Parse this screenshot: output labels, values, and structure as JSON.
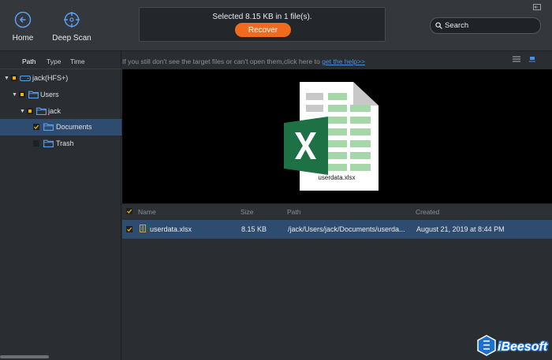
{
  "toolbar": {
    "home_label": "Home",
    "deep_scan_label": "Deep Scan",
    "status_text": "Selected 8.15 KB in 1 file(s).",
    "recover_label": "Recover",
    "search_placeholder": "Search"
  },
  "sidebar": {
    "tabs": [
      {
        "label": "Path",
        "active": true
      },
      {
        "label": "Type",
        "active": false
      },
      {
        "label": "Time",
        "active": false
      }
    ],
    "tree": [
      {
        "label": "jack(HFS+)",
        "expanded": true,
        "check": "partial",
        "icon": "drive-icon"
      },
      {
        "label": "Users",
        "expanded": true,
        "check": "partial",
        "icon": "folder-icon"
      },
      {
        "label": "jack",
        "expanded": true,
        "check": "partial",
        "icon": "folder-icon"
      },
      {
        "label": "Documents",
        "check": "checked",
        "selected": true,
        "icon": "folder-icon"
      },
      {
        "label": "Trash",
        "check": "unchecked",
        "icon": "folder-icon"
      }
    ]
  },
  "hint": {
    "text": "If you still don't see the target files or can't open them,click here to ",
    "link": "get the help>>"
  },
  "preview": {
    "file_name": "userdata.xlsx"
  },
  "table": {
    "headers": {
      "name": "Name",
      "size": "Size",
      "path": "Path",
      "created": "Created"
    },
    "rows": [
      {
        "name": "userdata.xlsx",
        "size": "8.15 KB",
        "path": "/jack/Users/jack/Documents/userda...",
        "created": "August 21, 2019 at 8:44 PM",
        "checked": true
      }
    ]
  },
  "brand": {
    "logo": "iBeesoft"
  },
  "colors": {
    "accent": "#f26a1b",
    "selection": "#2e4c70",
    "link": "#4b8fe0",
    "excel_green": "#1e7145"
  }
}
